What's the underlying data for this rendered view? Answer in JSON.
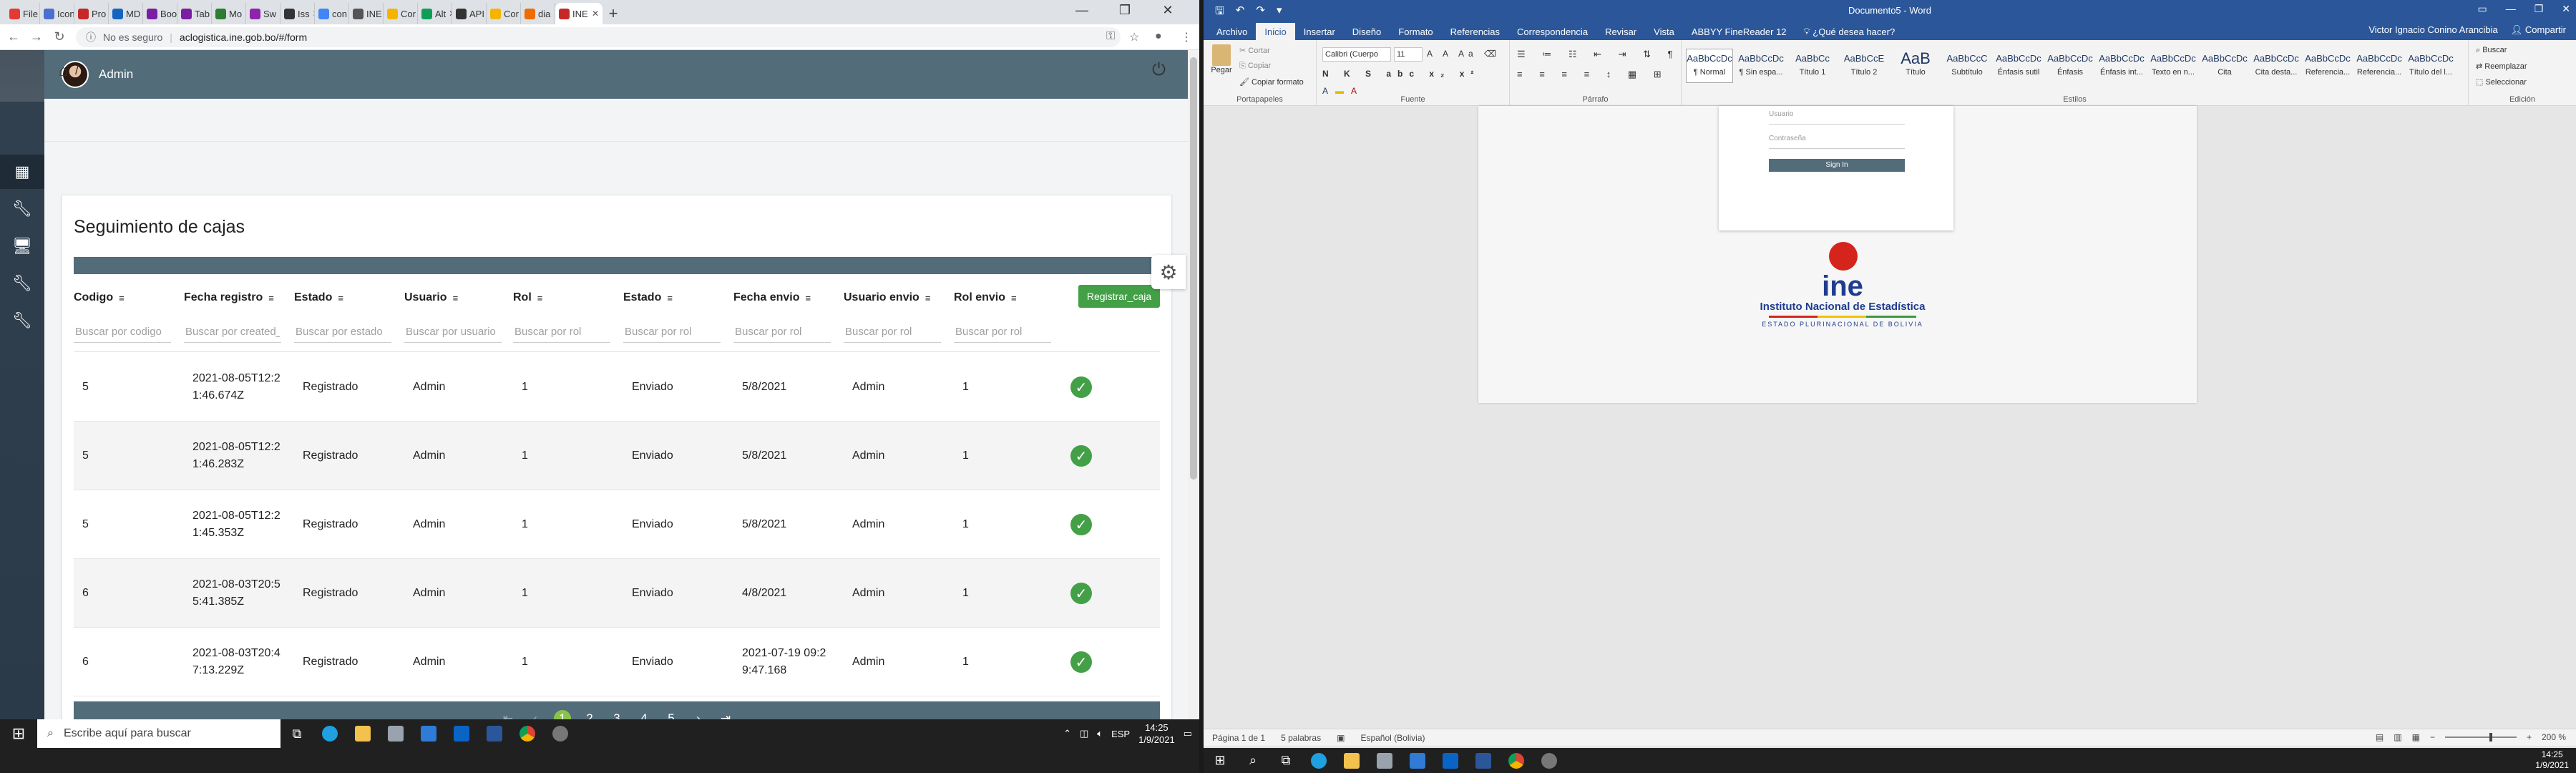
{
  "browser": {
    "tabs": [
      {
        "label": "File",
        "color": "#e53935"
      },
      {
        "label": "Icono",
        "color": "#4a6fd1"
      },
      {
        "label": "Pro",
        "color": "#c62828"
      },
      {
        "label": "MD",
        "color": "#1565c0"
      },
      {
        "label": "Boo",
        "color": "#7b1fa2"
      },
      {
        "label": "Tab",
        "color": "#7b1fa2"
      },
      {
        "label": "Mo",
        "color": "#2e7d32"
      },
      {
        "label": "Sw",
        "color": "#8e24aa"
      },
      {
        "label": "Iss",
        "color": "#333333"
      },
      {
        "label": "con",
        "color": "#4285f4"
      },
      {
        "label": "INE",
        "color": "#555555"
      },
      {
        "label": "Cor",
        "color": "#f4b400"
      },
      {
        "label": "Alt",
        "color": "#0f9d58"
      },
      {
        "label": "API",
        "color": "#333333"
      },
      {
        "label": "Cor",
        "color": "#f4b400"
      },
      {
        "label": "dia",
        "color": "#ef6c00"
      },
      {
        "label": "INE",
        "color": "#c62828",
        "active": true
      }
    ],
    "insecure_label": "No es seguro",
    "url": "aclogistica.ine.gob.bo/#/form"
  },
  "app": {
    "user_name": "Admin",
    "breadcrumb_sep": "/",
    "page_title": "Seguimiento de cajas",
    "register_label": "Registrar_caja",
    "columns": [
      "Codigo",
      "Fecha registro",
      "Estado",
      "Usuario",
      "Rol",
      "Estado",
      "Fecha envio",
      "Usuario envio",
      "Rol envio"
    ],
    "filters": [
      "Buscar por codigo",
      "Buscar por created_at",
      "Buscar por estado",
      "Buscar por usuario",
      "Buscar por rol",
      "Buscar por rol",
      "Buscar por rol",
      "Buscar por rol",
      "Buscar por rol"
    ],
    "rows": [
      {
        "codigo": "5",
        "fecha": "2021-08-05T12:21:46.674Z",
        "estado": "Registrado",
        "usuario": "Admin",
        "rol": "1",
        "estado2": "Enviado",
        "fecha_envio": "5/8/2021",
        "usuario_envio": "Admin",
        "rol_envio": "1"
      },
      {
        "codigo": "5",
        "fecha": "2021-08-05T12:21:46.283Z",
        "estado": "Registrado",
        "usuario": "Admin",
        "rol": "1",
        "estado2": "Enviado",
        "fecha_envio": "5/8/2021",
        "usuario_envio": "Admin",
        "rol_envio": "1"
      },
      {
        "codigo": "5",
        "fecha": "2021-08-05T12:21:45.353Z",
        "estado": "Registrado",
        "usuario": "Admin",
        "rol": "1",
        "estado2": "Enviado",
        "fecha_envio": "5/8/2021",
        "usuario_envio": "Admin",
        "rol_envio": "1"
      },
      {
        "codigo": "6",
        "fecha": "2021-08-03T20:55:41.385Z",
        "estado": "Registrado",
        "usuario": "Admin",
        "rol": "1",
        "estado2": "Enviado",
        "fecha_envio": "4/8/2021",
        "usuario_envio": "Admin",
        "rol_envio": "1"
      },
      {
        "codigo": "6",
        "fecha": "2021-08-03T20:47:13.229Z",
        "estado": "Registrado",
        "usuario": "Admin",
        "rol": "1",
        "estado2": "Enviado",
        "fecha_envio": "2021-07-19 09:29:47.168",
        "usuario_envio": "Admin",
        "rol_envio": "1"
      }
    ],
    "pager": {
      "pages": [
        "1",
        "2",
        "3",
        "4",
        "5"
      ],
      "current": "1"
    }
  },
  "taskbar_left": {
    "search_placeholder": "Escribe aquí para buscar",
    "lang": "ESP",
    "time": "14:25",
    "date": "1/9/2021"
  },
  "word": {
    "title": "Documento5 - Word",
    "tabs": [
      "Archivo",
      "Inicio",
      "Insertar",
      "Diseño",
      "Formato",
      "Referencias",
      "Correspondencia",
      "Revisar",
      "Vista",
      "ABBYY FineReader 12"
    ],
    "tell_me": "¿Qué desea hacer?",
    "user": "Victor Ignacio Conino Arancibia",
    "share": "Compartir",
    "clipboard": {
      "paste": "Pegar",
      "cut": "Cortar",
      "copy": "Copiar",
      "format": "Copiar formato",
      "label": "Portapapeles"
    },
    "font": {
      "name": "Calibri (Cuerpo",
      "size": "11",
      "label": "Fuente"
    },
    "paragraph_label": "Párrafo",
    "styles": [
      {
        "sample": "AaBbCcDc",
        "name": "¶ Normal",
        "sel": true
      },
      {
        "sample": "AaBbCcDc",
        "name": "¶ Sin espa..."
      },
      {
        "sample": "AaBbCc",
        "name": "Título 1"
      },
      {
        "sample": "AaBbCcE",
        "name": "Título 2"
      },
      {
        "sample": "AaB",
        "name": "Título"
      },
      {
        "sample": "AaBbCcC",
        "name": "Subtítulo"
      },
      {
        "sample": "AaBbCcDc",
        "name": "Énfasis sutil"
      },
      {
        "sample": "AaBbCcDc",
        "name": "Énfasis"
      },
      {
        "sample": "AaBbCcDc",
        "name": "Énfasis int..."
      },
      {
        "sample": "AaBbCcDc",
        "name": "Texto en n..."
      },
      {
        "sample": "AaBbCcDc",
        "name": "Cita"
      },
      {
        "sample": "AaBbCcDc",
        "name": "Cita desta..."
      },
      {
        "sample": "AaBbCcDc",
        "name": "Referencia..."
      },
      {
        "sample": "AaBbCcDc",
        "name": "Referencia..."
      },
      {
        "sample": "AaBbCcDc",
        "name": "Título del l..."
      }
    ],
    "styles_label": "Estilos",
    "editing": {
      "find": "Buscar",
      "replace": "Reemplazar",
      "select": "Seleccionar",
      "label": "Edición"
    },
    "login_preview": {
      "user": "Usuario",
      "pass": "Contraseña",
      "button": "Sign In"
    },
    "logo": {
      "abbr": "ine",
      "full": "Instituto Nacional de Estadística",
      "sub": "ESTADO PLURINACIONAL DE BOLIVIA"
    },
    "status": {
      "page": "Página 1 de 1",
      "words": "5 palabras",
      "lang": "Español (Bolivia)",
      "zoom": "200 %"
    },
    "time": "14:25",
    "date": "1/9/2021"
  }
}
